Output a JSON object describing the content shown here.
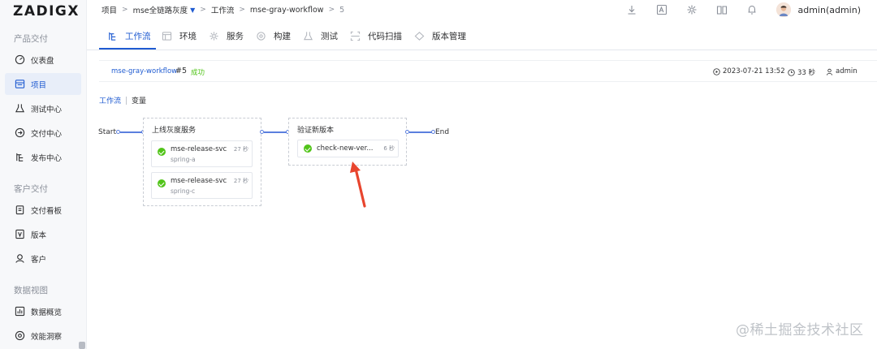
{
  "app": {
    "logo_text": "ZADIG",
    "logo_accent": "X"
  },
  "sidebar": {
    "sections": [
      {
        "title": "产品交付",
        "items": [
          {
            "label": "仪表盘",
            "icon": "dashboard-icon"
          },
          {
            "label": "项目",
            "icon": "project-icon",
            "active": true
          },
          {
            "label": "测试中心",
            "icon": "flask-icon"
          },
          {
            "label": "交付中心",
            "icon": "delivery-icon"
          },
          {
            "label": "发布中心",
            "icon": "release-icon"
          }
        ]
      },
      {
        "title": "客户交付",
        "items": [
          {
            "label": "交付看板",
            "icon": "clipboard-icon"
          },
          {
            "label": "版本",
            "icon": "version-icon"
          },
          {
            "label": "客户",
            "icon": "customers-icon"
          }
        ]
      },
      {
        "title": "数据视图",
        "items": [
          {
            "label": "数据概览",
            "icon": "chart-icon"
          },
          {
            "label": "效能洞察",
            "icon": "insight-icon"
          }
        ]
      }
    ]
  },
  "breadcrumb": {
    "items": [
      "项目",
      "mse全链路灰度",
      "工作流",
      "mse-gray-workflow",
      "5"
    ]
  },
  "header": {
    "user": "admin(admin)"
  },
  "tabs": [
    {
      "label": "工作流",
      "active": true
    },
    {
      "label": "环境"
    },
    {
      "label": "服务"
    },
    {
      "label": "构建"
    },
    {
      "label": "测试"
    },
    {
      "label": "代码扫描"
    },
    {
      "label": "版本管理"
    }
  ],
  "run": {
    "workflow": "mse-gray-workflow",
    "number": "#5",
    "status": "成功",
    "time": "2023-07-21 13:52",
    "duration": "33 秒",
    "user": "admin"
  },
  "subtabs": {
    "workflow": "工作流",
    "variables": "变量"
  },
  "pipeline": {
    "start": "Start",
    "end": "End",
    "stages": [
      {
        "title": "上线灰度服务",
        "jobs": [
          {
            "name": "mse-release-svc",
            "sub": "spring-a",
            "time": "27 秒"
          },
          {
            "name": "mse-release-svc",
            "sub": "spring-c",
            "time": "27 秒"
          }
        ]
      },
      {
        "title": "验证新版本",
        "jobs": [
          {
            "name": "check-new-ver...",
            "time": "6 秒"
          }
        ]
      }
    ]
  },
  "watermark": "@稀土掘金技术社区",
  "colors": {
    "accent": "#1f5bd1",
    "success": "#52c41a",
    "arrow": "#e8452e"
  }
}
